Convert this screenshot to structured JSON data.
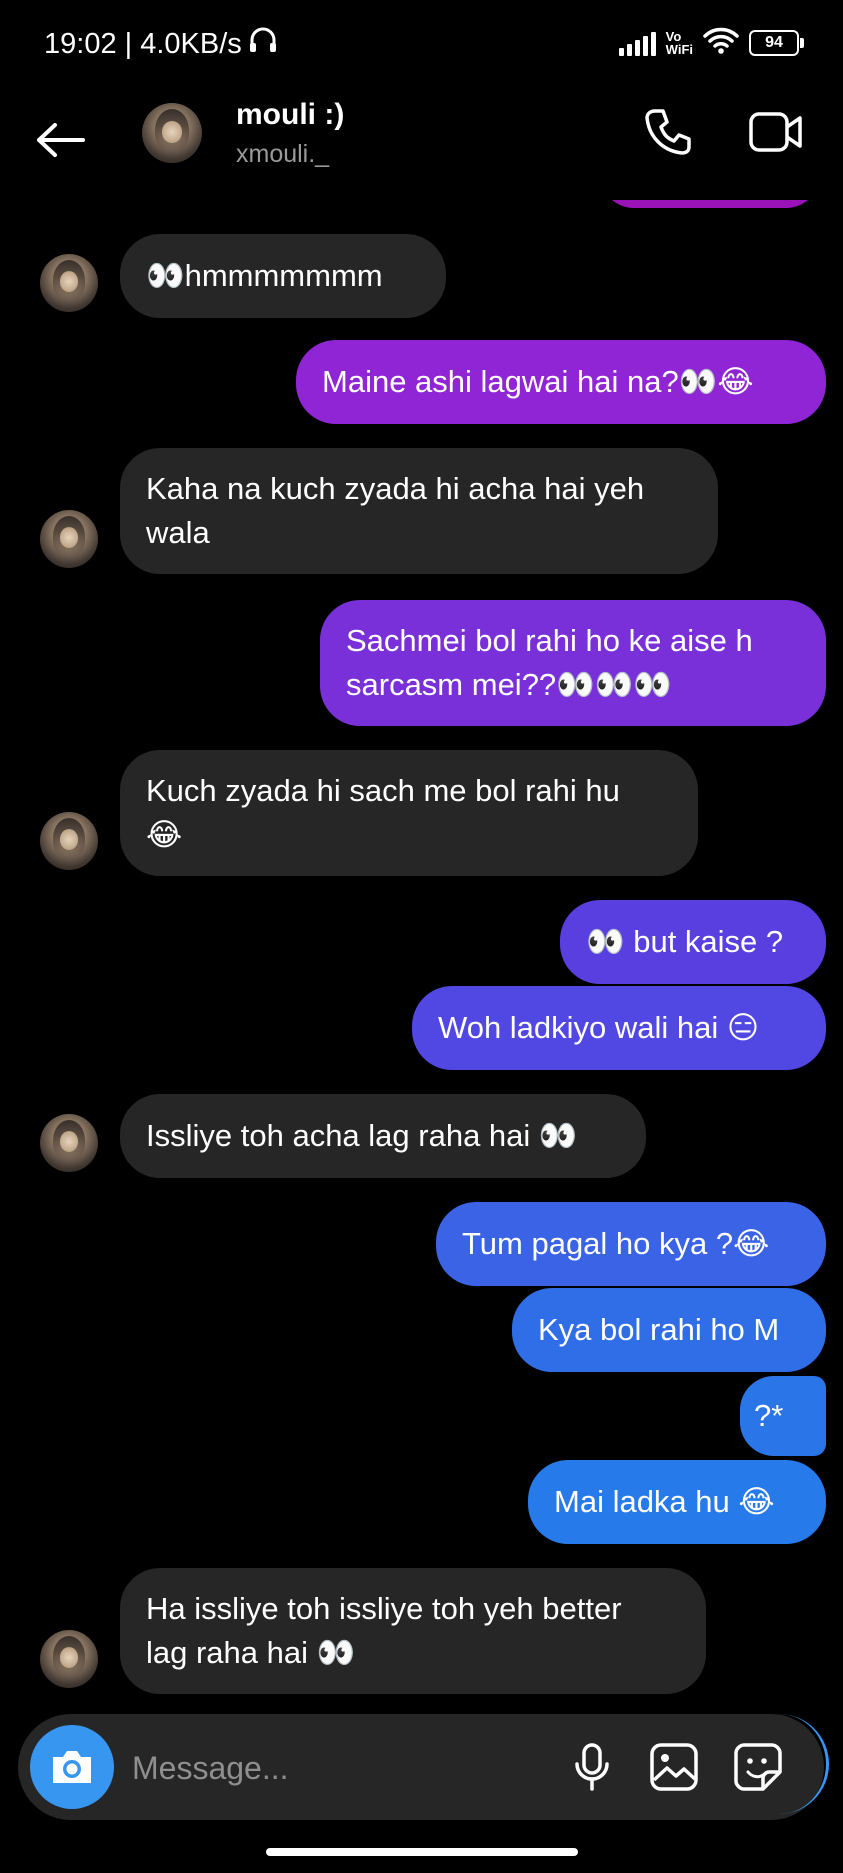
{
  "status_bar": {
    "time_speed": "19:02 | 4.0KB/s",
    "network_label_top": "Vo",
    "network_label_bottom": "WiFi",
    "battery": "94"
  },
  "header": {
    "name": "mouli :)",
    "handle": "xmouli._"
  },
  "messages": [
    {
      "side": "in",
      "text": "👀hmmmmmmm",
      "avatar": true
    },
    {
      "side": "out",
      "text": "Maine ashi lagwai hai na?👀😂",
      "color": "#8f25d4"
    },
    {
      "side": "in",
      "text": "Kaha na kuch zyada hi acha hai yeh\nwala",
      "avatar": true
    },
    {
      "side": "out",
      "text": "Sachmei bol rahi ho ke aise h\nsarcasm mei??👀👀👀",
      "color": "#7a30d8"
    },
    {
      "side": "in",
      "text": "Kuch zyada hi sach me bol rahi hu\n😂",
      "avatar": true
    },
    {
      "side": "out",
      "text": "👀 but kaise ?",
      "color": "#5a3fe0"
    },
    {
      "side": "out",
      "text": "Woh ladkiyo wali hai 😑",
      "color": "#5147e2"
    },
    {
      "side": "in",
      "text": "Issliye toh acha lag raha hai 👀",
      "avatar": true
    },
    {
      "side": "out",
      "text": "Tum pagal ho kya ?😂",
      "color": "#3a63e6"
    },
    {
      "side": "out",
      "text": "Kya bol rahi ho M",
      "color": "#2f6ee7"
    },
    {
      "side": "out",
      "text": "?*",
      "color": "#2a75e8"
    },
    {
      "side": "out",
      "text": "Mai ladka hu 😂",
      "color": "#277ae9"
    },
    {
      "side": "in",
      "text": "Ha issliye toh issliye toh yeh better\nlag raha hai 👀",
      "avatar": true
    }
  ],
  "composer": {
    "placeholder": "Message..."
  },
  "icons": {
    "back": "arrow-left",
    "call": "phone",
    "video": "video-camera",
    "camera": "camera",
    "mic": "microphone",
    "gallery": "image",
    "sticker": "sticker"
  },
  "colors": {
    "incoming_bubble": "#262626",
    "accent": "#3797f0",
    "background": "#000000"
  }
}
